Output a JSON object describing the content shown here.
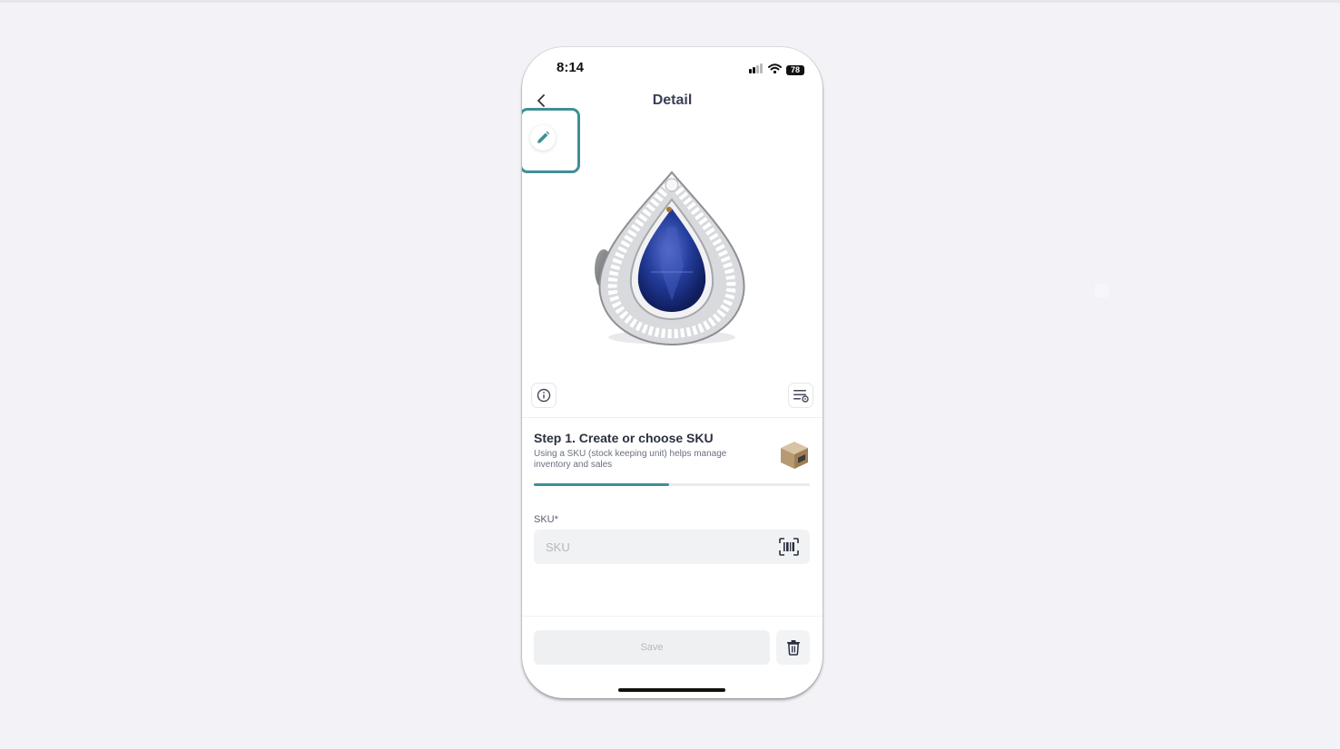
{
  "status_bar": {
    "time": "8:14",
    "battery": "78",
    "icons": [
      "signal-icon",
      "wifi-icon",
      "battery-icon"
    ]
  },
  "header": {
    "title": "Detail",
    "back_icon": "chevron-left-icon"
  },
  "edit_button": {
    "icon": "pencil-icon"
  },
  "product": {
    "image": "blue-sapphire-pear-halo-ring"
  },
  "toolbar": {
    "info_icon": "info-icon",
    "settings_icon": "list-settings-icon"
  },
  "step": {
    "title": "Step 1. Create or choose SKU",
    "description": "Using a SKU (stock keeping unit) helps manage inventory and sales",
    "icon": "box-icon",
    "progress": 0.49
  },
  "sku": {
    "label": "SKU*",
    "placeholder": "SKU",
    "value": "",
    "scan_icon": "barcode-scan-icon"
  },
  "footer": {
    "save_label": "Save",
    "delete_icon": "trash-icon"
  },
  "colors": {
    "accent": "#3f8f95",
    "background": "#f3f3f7",
    "text_primary": "#2b3040"
  }
}
